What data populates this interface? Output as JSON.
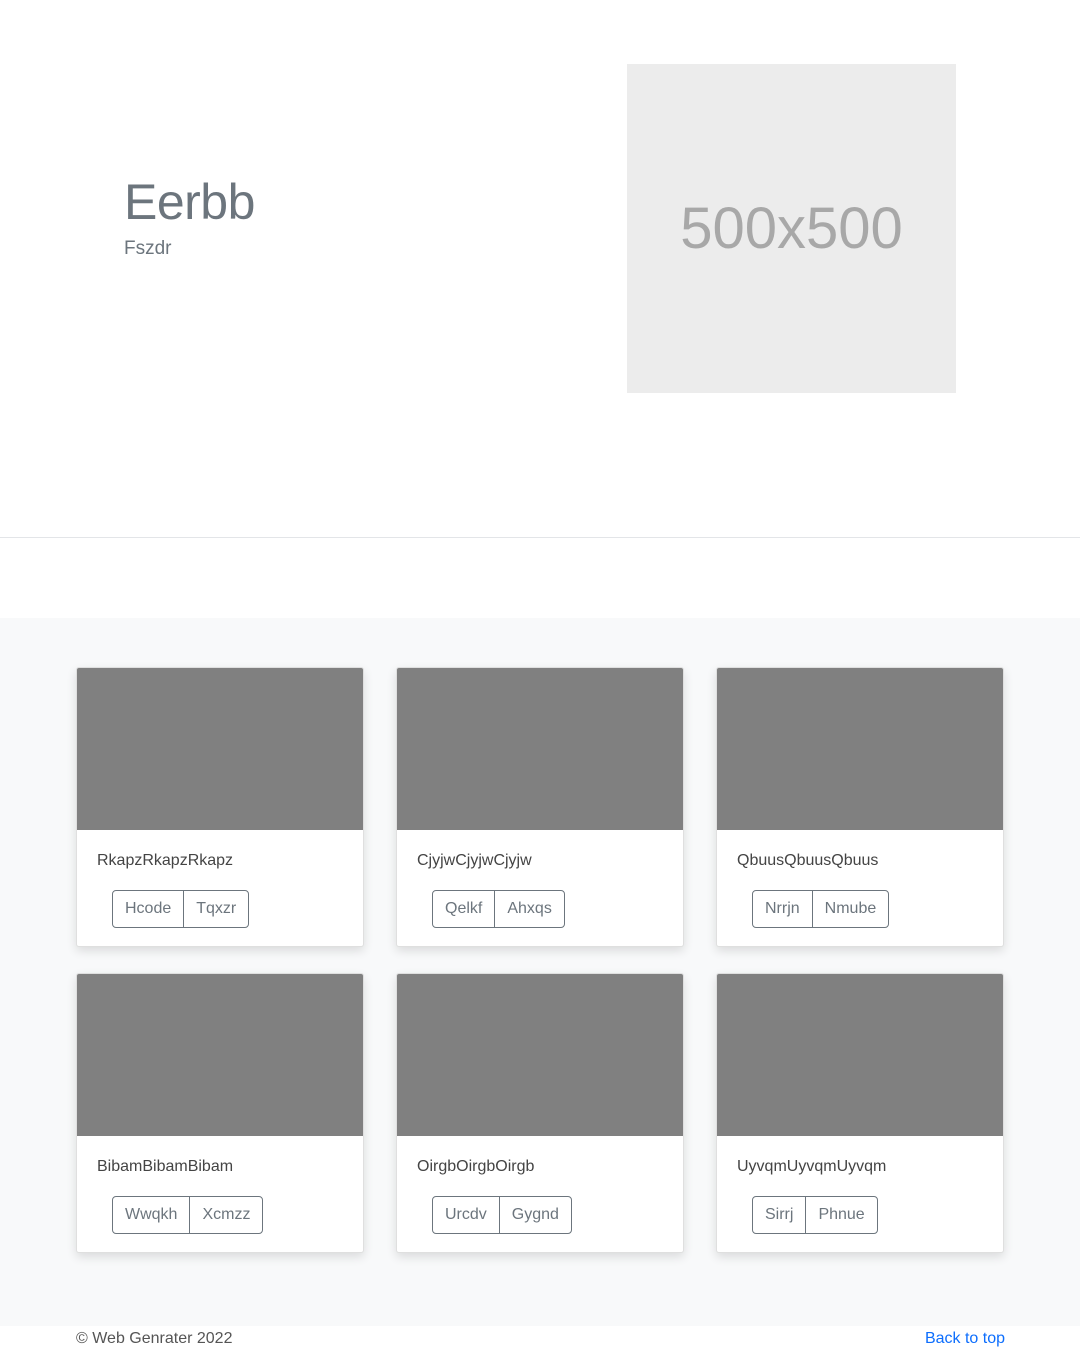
{
  "hero": {
    "title": "Eerbb",
    "subtitle": "Fszdr",
    "image_placeholder": "500x500"
  },
  "cards": [
    {
      "text": "RkapzRkapzRkapz",
      "buttons": [
        "Hcode",
        "Tqxzr"
      ]
    },
    {
      "text": "CjyjwCjyjwCjyjw",
      "buttons": [
        "Qelkf",
        "Ahxqs"
      ]
    },
    {
      "text": "QbuusQbuusQbuus",
      "buttons": [
        "Nrrjn",
        "Nmube"
      ]
    },
    {
      "text": "BibamBibamBibam",
      "buttons": [
        "Wwqkh",
        "Xcmzz"
      ]
    },
    {
      "text": "OirgbOirgbOirgb",
      "buttons": [
        "Urcdv",
        "Gygnd"
      ]
    },
    {
      "text": "UyvqmUyvqmUyvqm",
      "buttons": [
        "Sirrj",
        "Phnue"
      ]
    }
  ],
  "footer": {
    "copyright": "© Web Genrater 2022",
    "back_to_top": "Back to top"
  },
  "colors": {
    "thumbnail": "#808080",
    "album_background": "#f8f9fa",
    "link": "#0d6efd"
  }
}
